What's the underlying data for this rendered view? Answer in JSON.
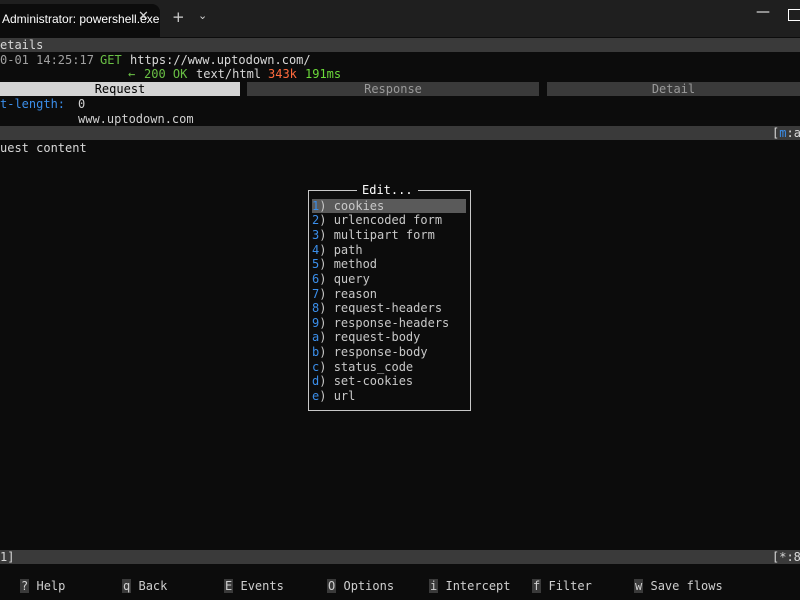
{
  "window": {
    "tab_title": "Administrator: powershell.exe",
    "close_glyph": "✕",
    "new_tab_glyph": "+",
    "dropdown_glyph": "⌄",
    "minimize_glyph": "—"
  },
  "flow_details": {
    "header": "etails",
    "date_time": "0-01 14:25:17",
    "method": "GET",
    "url": "https://www.uptodown.com/",
    "response_arrow": "←",
    "status": "200 OK",
    "content_type": "text/html",
    "size": "343k",
    "duration": "191ms"
  },
  "tabs": [
    {
      "label": "Request",
      "active": true
    },
    {
      "label": "Response",
      "active": false
    },
    {
      "label": "Detail",
      "active": false
    }
  ],
  "request": {
    "header_name": "t-length:",
    "header_value": "0",
    "host_value": "www.uptodown.com",
    "divider_right": "[",
    "divider_right_key": "m",
    "divider_right_tail": ":a",
    "content_label": "uest content"
  },
  "edit_dialog": {
    "title": "Edit...",
    "options": [
      {
        "key": "1",
        "label": "cookies",
        "selected": true
      },
      {
        "key": "2",
        "label": "urlencoded form"
      },
      {
        "key": "3",
        "label": "multipart form"
      },
      {
        "key": "4",
        "label": "path"
      },
      {
        "key": "5",
        "label": "method"
      },
      {
        "key": "6",
        "label": "query"
      },
      {
        "key": "7",
        "label": "reason"
      },
      {
        "key": "8",
        "label": "request-headers"
      },
      {
        "key": "9",
        "label": "response-headers"
      },
      {
        "key": "a",
        "label": "request-body"
      },
      {
        "key": "b",
        "label": "response-body"
      },
      {
        "key": "c",
        "label": "status_code"
      },
      {
        "key": "d",
        "label": "set-cookies"
      },
      {
        "key": "e",
        "label": "url"
      }
    ]
  },
  "status_bar": {
    "left": "1]",
    "right": "[*:8"
  },
  "footer": [
    {
      "key": "?",
      "label": "Help"
    },
    {
      "key": "q",
      "label": "Back"
    },
    {
      "key": "E",
      "label": "Events"
    },
    {
      "key": "O",
      "label": "Options"
    },
    {
      "key": "i",
      "label": "Intercept"
    },
    {
      "key": "f",
      "label": "Filter"
    },
    {
      "key": "w",
      "label": "Save flows"
    }
  ]
}
